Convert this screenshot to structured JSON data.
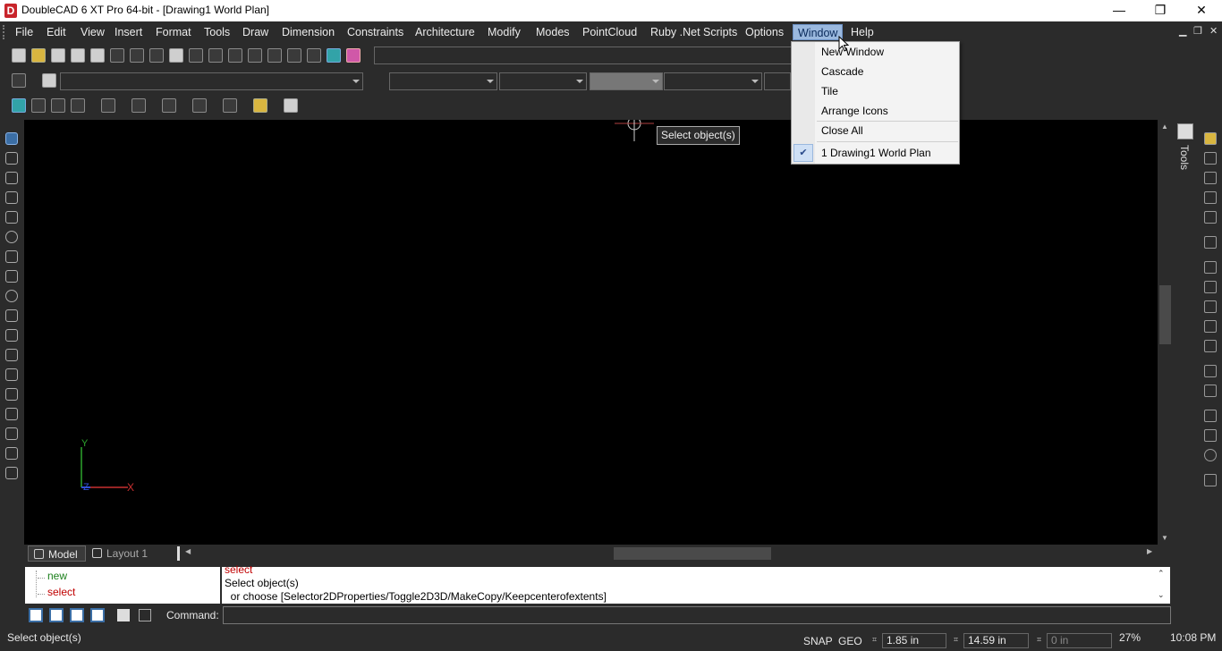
{
  "window": {
    "title": "DoubleCAD 6 XT Pro 64-bit - [Drawing1 World Plan]",
    "logo_letter": "D",
    "minimize": "—",
    "restore": "❐",
    "close": "✕"
  },
  "menubar": {
    "items": [
      "File",
      "Edit",
      "View",
      "Insert",
      "Format",
      "Tools",
      "Draw",
      "Dimension",
      "Constraints",
      "Architecture",
      "Modify",
      "Modes",
      "PointCloud",
      "Ruby .Net Scripts",
      "Options",
      "Window",
      "Help"
    ],
    "active": "Window",
    "mdi_min": "▁",
    "mdi_restore": "❐",
    "mdi_close": "✕"
  },
  "window_menu": {
    "items": [
      "New Window",
      "Cascade",
      "Tile",
      "Arrange Icons",
      "Close All",
      "1 Drawing1 World Plan"
    ],
    "checked": "1 Drawing1 World Plan",
    "check_glyph": "✔"
  },
  "canvas": {
    "tooltip": "Select object(s)",
    "axis_y": "Y",
    "axis_x": "X",
    "axis_z": "Z",
    "background": "#000000"
  },
  "right_panel": {
    "tools_label": "Tools"
  },
  "tabs": [
    {
      "label": "Model",
      "icon": "model-tab-icon"
    },
    {
      "label": "Layout 1",
      "icon": "layout-tab-icon"
    }
  ],
  "command_history": {
    "tree": [
      {
        "label": "new",
        "color": "#1a7f1a"
      },
      {
        "label": "select",
        "color": "#c00000"
      }
    ],
    "lines": [
      {
        "text": "select",
        "color": "#c00000"
      },
      {
        "text": "Select object(s)",
        "color": "#000000"
      },
      {
        "text": "  or choose [Selector2DProperties/Toggle2D3D/MakeCopy/Keepcenterofextents]",
        "color": "#000000"
      }
    ]
  },
  "command": {
    "label": "Command:",
    "value": ""
  },
  "statusbar": {
    "message": "Select object(s)",
    "snap": "SNAP",
    "geo": "GEO",
    "x_value": "1.85 in",
    "y_value": "14.59 in",
    "z_value": "0 in",
    "zoom": "27%",
    "time": "10:08 PM"
  }
}
